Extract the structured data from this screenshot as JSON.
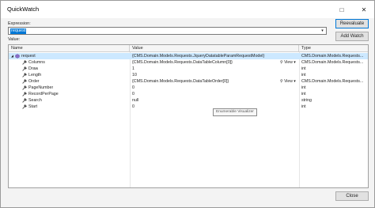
{
  "window": {
    "title": "QuickWatch",
    "minimize_glyph": "□",
    "close_glyph": "✕"
  },
  "expression": {
    "label": "Expression:",
    "value": "request",
    "dropdown_glyph": "▾"
  },
  "buttons": {
    "reevaluate": "Reevaluate",
    "add_watch": "Add Watch",
    "close": "Close"
  },
  "value_label": "Value:",
  "grid": {
    "columns": [
      "Name",
      "Value",
      "Type"
    ],
    "rows": [
      {
        "name": "request",
        "value": "{CMS.Domain.Models.Requests.JqueryDatatableParamRequestModel}",
        "type": "CMS.Domain.Models.Requests...",
        "icon": "object-icon",
        "expand": "◢",
        "selected": true,
        "view": ""
      },
      {
        "name": "Columns",
        "value": "{CMS.Domain.Models.Requests.DataTableColumn[0]}",
        "type": "CMS.Domain.Models.Requests...",
        "icon": "wrench-property-icon",
        "expand": "",
        "selected": false,
        "view": "View"
      },
      {
        "name": "Draw",
        "value": "1",
        "type": "int",
        "icon": "wrench-property-icon",
        "expand": "",
        "selected": false,
        "view": ""
      },
      {
        "name": "Length",
        "value": "10",
        "type": "int",
        "icon": "wrench-property-icon",
        "expand": "",
        "selected": false,
        "view": ""
      },
      {
        "name": "Order",
        "value": "{CMS.Domain.Models.Requests.DataTableOrder[0]}",
        "type": "CMS.Domain.Models.Requests...",
        "icon": "wrench-property-icon",
        "expand": "",
        "selected": false,
        "view": "View"
      },
      {
        "name": "PageNumber",
        "value": "0",
        "type": "int",
        "icon": "wrench-property-icon",
        "expand": "",
        "selected": false,
        "view": ""
      },
      {
        "name": "RecordPerPage",
        "value": "0",
        "type": "int",
        "icon": "wrench-property-icon",
        "expand": "",
        "selected": false,
        "view": ""
      },
      {
        "name": "Search",
        "value": "null",
        "type": "string",
        "icon": "wrench-property-icon",
        "expand": "",
        "selected": false,
        "view": ""
      },
      {
        "name": "Start",
        "value": "0",
        "type": "int",
        "icon": "wrench-property-icon",
        "expand": "",
        "selected": false,
        "view": ""
      }
    ],
    "tooltip": "Enumerable Visualizer"
  },
  "colors": {
    "accent": "#0078d7",
    "selected_row": "#cce8ff",
    "object_icon": "#8a6fc9",
    "property_icon": "#444444"
  }
}
